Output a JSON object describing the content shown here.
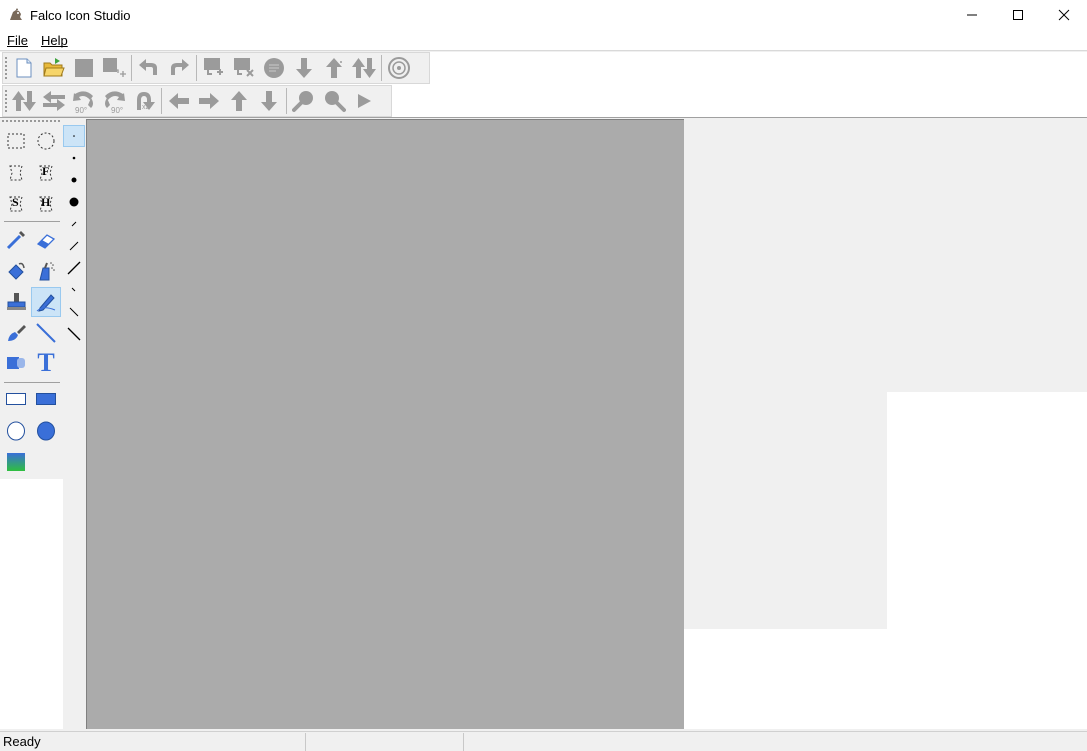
{
  "window": {
    "title": "Falco Icon Studio"
  },
  "menu": {
    "file": "File",
    "help": "Help"
  },
  "toolbar1": [
    "new-file",
    "open-folder",
    "save",
    "save-as",
    "undo",
    "redo",
    "add-image",
    "delete-image",
    "image-format",
    "move-down",
    "move-up",
    "swap",
    "target"
  ],
  "toolbar2": [
    "flip-vertical",
    "flip-horizontal",
    "rotate-ccw-90",
    "rotate-cw-90",
    "rotate-180",
    "shift-left",
    "shift-right",
    "shift-up",
    "shift-down",
    "zoom-in",
    "zoom-out",
    "play"
  ],
  "tools": {
    "text_glyph": "T",
    "magic_f": "F",
    "magic_s": "S",
    "magic_h": "H"
  },
  "status": {
    "text": "Ready"
  },
  "colors": {
    "accent": "#3a6fd8",
    "canvas": "#ababab",
    "panel": "#f0f0f0"
  }
}
